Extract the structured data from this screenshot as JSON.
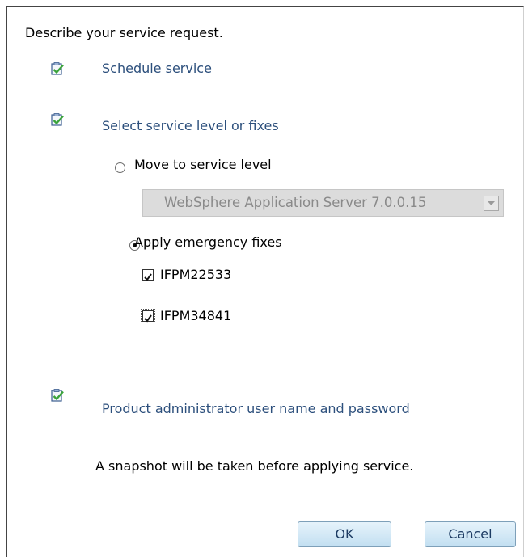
{
  "intro": "Describe your service request.",
  "steps": {
    "schedule": {
      "label": "Schedule service",
      "icon": "task-complete-icon"
    },
    "select_level": {
      "label": "Select service level or fixes",
      "icon": "task-complete-icon"
    },
    "admin_credentials": {
      "label": "Product administrator user name and password",
      "icon": "task-complete-icon"
    }
  },
  "options": {
    "move_to_level": {
      "label": "Move to service level",
      "selected": false
    },
    "service_level_select": {
      "value": "WebSphere Application Server 7.0.0.15",
      "disabled": true
    },
    "apply_fixes": {
      "label": "Apply emergency fixes",
      "selected": true
    },
    "fixes": [
      {
        "label": "IFPM22533",
        "checked": true
      },
      {
        "label": "IFPM34841",
        "checked": true
      }
    ]
  },
  "note": "A snapshot will be taken before applying service.",
  "buttons": {
    "ok": "OK",
    "cancel": "Cancel"
  },
  "colors": {
    "link": "#2c4f7c",
    "check_green": "#3aa33a",
    "button_border": "#7ea0b9"
  }
}
